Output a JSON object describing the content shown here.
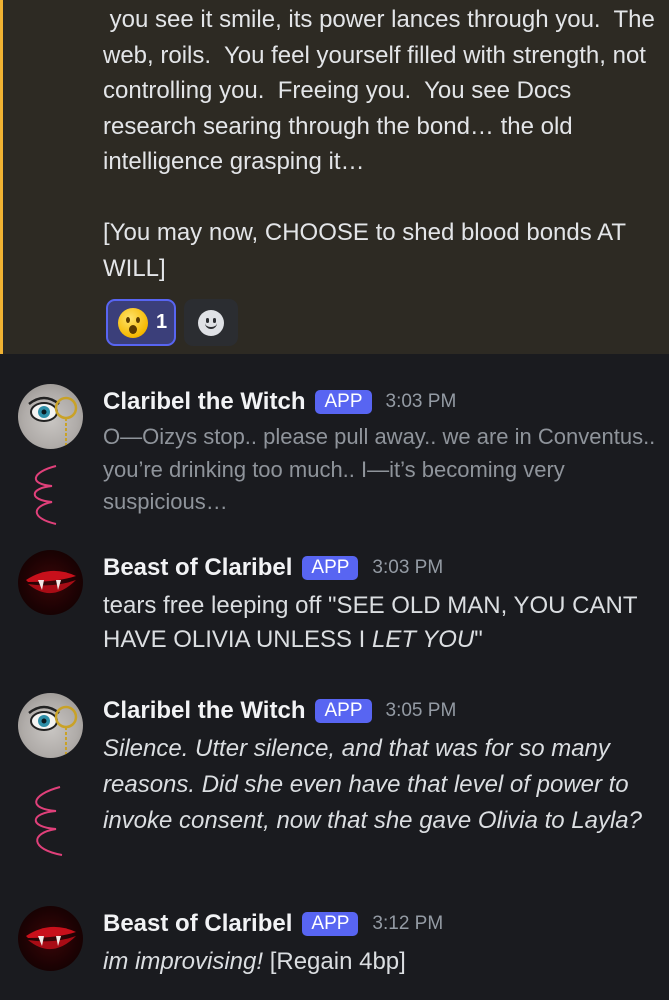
{
  "highlight": {
    "text": " you see it smile, its power lances through you.  The web, roils.  You feel yourself filled with strength, not controlling you.  Freeing you.  You see Docs research searing through the bond… the old intelligence grasping it…\n\n[You may now, CHOOSE to shed blood bonds AT WILL]",
    "reactions": [
      {
        "emoji": "hushed-face-emoji",
        "count": "1"
      },
      {
        "emoji": "add-reaction-icon"
      }
    ]
  },
  "messages": [
    {
      "author": "Claribel the Witch",
      "tag": "APP",
      "time": "3:03 PM",
      "text": "O—Oizys stop.. please pull away.. we are in Conventus.. you’re drinking too much.. I—it’s becoming very suspicious…",
      "avatar_label": "me"
    },
    {
      "author": "Beast of Claribel",
      "tag": "APP",
      "time": "3:03 PM",
      "text_before": "tears free leeping off \"SEE OLD MAN, YOU CANT HAVE OLIVIA UNLESS I ",
      "text_em": "LET YOU",
      "text_after": "\""
    },
    {
      "author": "Claribel the Witch",
      "tag": "APP",
      "time": "3:05 PM",
      "text": "Silence. Utter silence, and that was for so many reasons. Did she even have that level of power to invoke consent, now that she gave Olivia to Layla?",
      "avatar_label": "me"
    },
    {
      "author": "Beast of Claribel",
      "tag": "APP",
      "time": "3:12 PM",
      "text_em": "im improvising!",
      "text_after": " [Regain 4bp]"
    }
  ],
  "colors": {
    "highlight_bar": "#f0b232",
    "app_tag": "#5865f2",
    "scribble": "#e0407a"
  }
}
